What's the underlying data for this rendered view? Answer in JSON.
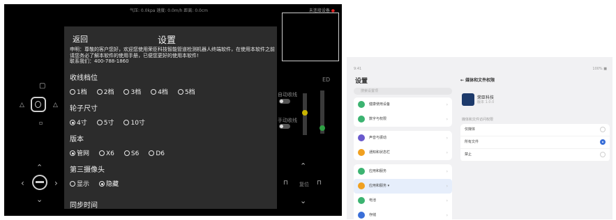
{
  "robot_app": {
    "status_bar": {
      "center": "气压: 0.0kpa 速度: 0.0m/h 距离: 0.0cm",
      "right": "未连接设备"
    },
    "controls": {
      "auto_retract_top": "自动收线",
      "auto_retract_bottom": "手动收线",
      "reset_label": "复位",
      "right_label_top": "ED"
    },
    "settings": {
      "back_label": "返回",
      "title": "设置",
      "notice": "申明：尊敬的客户您好，欢迎您使用荣臣科技智能管道检测机器人终端软件，在使用本软件之前请您务必了解本软件的使用手册，已便您更好的使用本软件!\n联系我们：400-788-1860",
      "sections": [
        {
          "label": "收线档位",
          "options": [
            "1档",
            "2档",
            "3档",
            "4档",
            "5档"
          ],
          "selected": -1
        },
        {
          "label": "轮子尺寸",
          "options": [
            "4寸",
            "5寸",
            "10寸"
          ],
          "selected": 0
        },
        {
          "label": "版本",
          "options": [
            "管网",
            "X6",
            "S6",
            "D6"
          ],
          "selected": 0
        },
        {
          "label": "第三摄像头",
          "options": [
            "显示",
            "隐藏"
          ],
          "selected": 1
        }
      ],
      "last_section": "同步时间"
    }
  },
  "tablet": {
    "status_left": "9:41",
    "status_right": "100% ■",
    "title": "设置",
    "search_placeholder": "搜索设置项",
    "menu_group1": [
      {
        "label": "健康使用设备",
        "color": "#3cb371"
      },
      {
        "label": "数字与权限",
        "color": "#3cb371"
      }
    ],
    "menu_group2": [
      {
        "label": "声音与振动",
        "color": "#6a5acd"
      },
      {
        "label": "通知和状态栏",
        "color": "#f0a020"
      }
    ],
    "menu_group3": [
      {
        "label": "应用和服务",
        "color": "#3cb371"
      },
      {
        "label": "应用和服务 ▾",
        "color": "#f0a020",
        "active": true
      },
      {
        "label": "电池",
        "color": "#3cb371"
      },
      {
        "label": "存储",
        "color": "#3a6fd8"
      }
    ],
    "detail": {
      "title": "← 媒体和文件权限",
      "app_name": "荣臣科技",
      "app_version": "版本 1.0.0",
      "section_label": "媒体和文件访问权限",
      "options": [
        {
          "label": "仅媒体",
          "selected": false
        },
        {
          "label": "所有文件",
          "selected": true
        },
        {
          "label": "禁止",
          "selected": false
        }
      ]
    }
  }
}
